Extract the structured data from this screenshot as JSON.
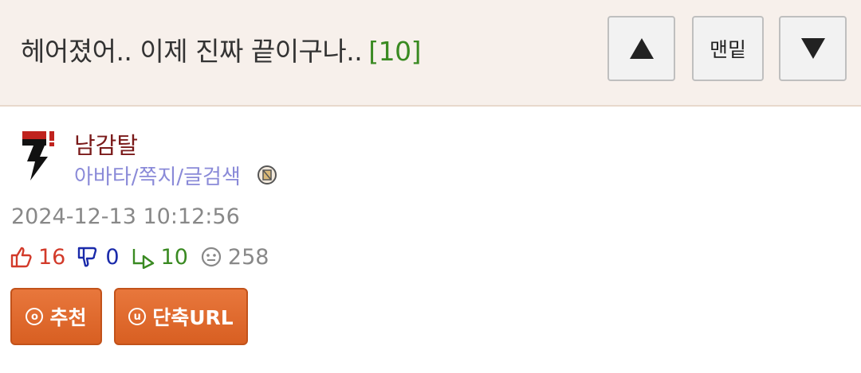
{
  "header": {
    "title": "헤어졌어.. 이제 진짜 끝이구나..",
    "reply_count": "[10]",
    "bottom_label": "맨밑"
  },
  "author": {
    "nickname": "남감탈",
    "links": "아바타/쪽지/글검색"
  },
  "post": {
    "datetime": "2024-12-13 10:12:56"
  },
  "stats": {
    "upvotes": "16",
    "downvotes": "0",
    "replies": "10",
    "views": "258"
  },
  "actions": {
    "recommend_label": "추천",
    "recommend_icon": "o",
    "shorturl_label": "단축URL",
    "shorturl_icon": "u"
  },
  "colors": {
    "header_bg": "#f7f0eb",
    "accent_orange": "#e06a2c",
    "reply_green": "#3a8a22",
    "up_red": "#d23a2a",
    "down_blue": "#1a2aaa",
    "nickname": "#7a1a1a",
    "link_purple": "#8a8ad8"
  }
}
